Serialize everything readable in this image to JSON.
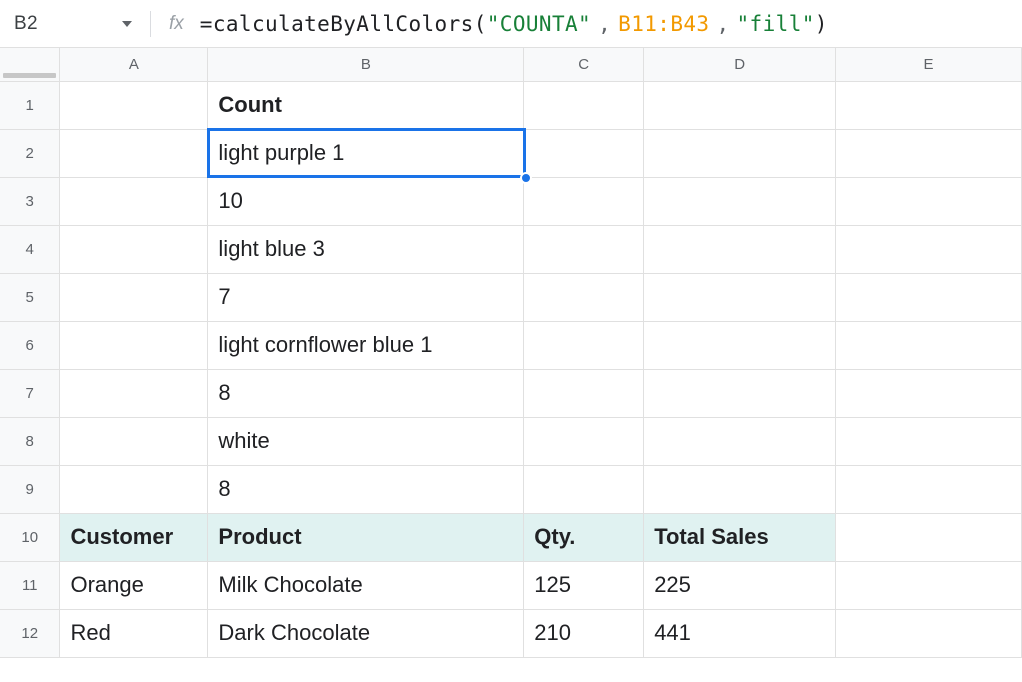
{
  "name_box": {
    "value": "B2"
  },
  "fx_label": "fx",
  "formula": {
    "eq": "=",
    "func": "calculateByAllColors",
    "open": "(",
    "arg1": "\"COUNTA\"",
    "sep1": ",",
    "arg2": "B11:B43",
    "sep2": ",",
    "arg3": "\"fill\"",
    "close": ")"
  },
  "columns": {
    "A": "A",
    "B": "B",
    "C": "C",
    "D": "D",
    "E": "E"
  },
  "rows": {
    "r1": {
      "num": "1",
      "B": "Count"
    },
    "r2": {
      "num": "2",
      "B": "light purple 1"
    },
    "r3": {
      "num": "3",
      "B": "10"
    },
    "r4": {
      "num": "4",
      "B": "light blue 3"
    },
    "r5": {
      "num": "5",
      "B": "7"
    },
    "r6": {
      "num": "6",
      "B": "light cornflower blue 1"
    },
    "r7": {
      "num": "7",
      "B": "8"
    },
    "r8": {
      "num": "8",
      "B": "white"
    },
    "r9": {
      "num": "9",
      "B": "8"
    },
    "r10": {
      "num": "10",
      "A": "Customer",
      "B": "Product",
      "C": "Qty.",
      "D": "Total Sales"
    },
    "r11": {
      "num": "11",
      "A": "Orange",
      "B": "Milk Chocolate",
      "C": "125",
      "D": "225"
    },
    "r12": {
      "num": "12",
      "A": "Red",
      "B": "Dark Chocolate",
      "C": "210",
      "D": "441"
    }
  },
  "colors": {
    "header_bg": "#e0f2f1",
    "purple_bg": "#8e7cc3",
    "blue_bg": "#c9daf8",
    "selection": "#1a73e8"
  }
}
